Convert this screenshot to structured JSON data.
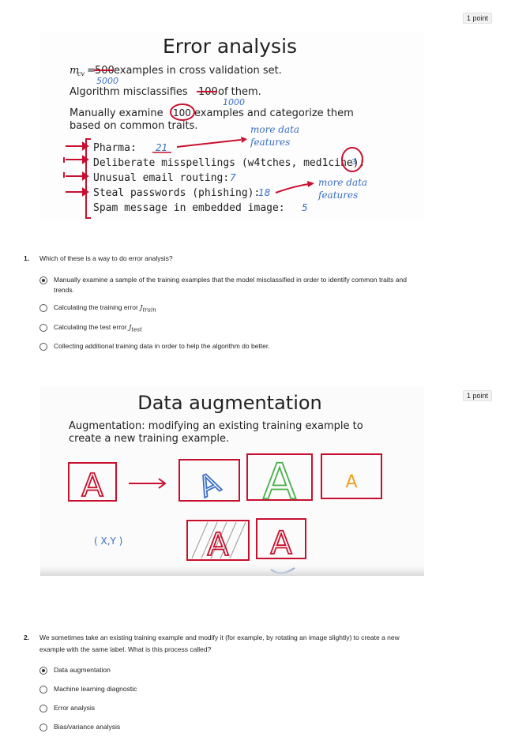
{
  "questions": [
    {
      "number": "1.",
      "points": "1 point",
      "prompt": "Which of these is a way to do error analysis?",
      "slide": {
        "title": "Error analysis",
        "line1_var": "m",
        "line1_sub": "cv",
        "line1_eq": "=",
        "line1_strike": "500",
        "line1_rest": " examples in cross validation set.",
        "line1_hand": "5000",
        "line2_pre": "Algorithm misclassifies ",
        "line2_strike": "100",
        "line2_rest": " of them.",
        "line2_hand": "1000",
        "line3_pre": "Manually examine ",
        "line3_circ": "100",
        "line3_rest": " examples and categorize them",
        "line4": "based on common traits.",
        "note_more_data_1a": "more data",
        "note_more_data_1b": "features",
        "cat1": "Pharma:",
        "cat1_count": "21",
        "cat2": "Deliberate misspellings (w4tches, med1cine):",
        "cat2_count": "3",
        "cat3": "Unusual email routing:",
        "cat3_count": "7",
        "cat4": "Steal passwords (phishing):",
        "cat4_count": "18",
        "cat5": "Spam message in embedded image:",
        "cat5_count": "5",
        "note_more_data_2a": "more data",
        "note_more_data_2b": "features"
      },
      "options": [
        {
          "label": "Manually examine a sample of the training examples that the model misclassified in order to identify common traits and trends.",
          "selected": true
        },
        {
          "label_pre": "Calculating the training error ",
          "math": "J",
          "math_sub": "train",
          "selected": false
        },
        {
          "label_pre": "Calculating the test error ",
          "math": "J",
          "math_sub": "test",
          "selected": false
        },
        {
          "label": "Collecting additional training data in order to help the algorithm do better.",
          "selected": false
        }
      ]
    },
    {
      "number": "2.",
      "points": "1 point",
      "prompt": "We sometimes take an existing training example and modify it (for example, by rotating an image slightly) to create a new example with the same label. What is this process called?",
      "slide": {
        "title": "Data augmentation",
        "subtitle_line1": "Augmentation: modifying an existing training example to",
        "subtitle_line2": "create a new training example.",
        "letter": "A",
        "xy_label": "( X,Y )"
      },
      "options": [
        {
          "label": "Data augmentation",
          "selected": true
        },
        {
          "label": "Machine learning diagnostic",
          "selected": false
        },
        {
          "label": "Error analysis",
          "selected": false
        },
        {
          "label": "Bias/variance analysis",
          "selected": false
        }
      ]
    }
  ],
  "colors": {
    "red_ink": "#c8102e",
    "blue_ink": "#3a6fc4",
    "green_ink": "#4bb04b",
    "orange_ink": "#f0a020"
  }
}
